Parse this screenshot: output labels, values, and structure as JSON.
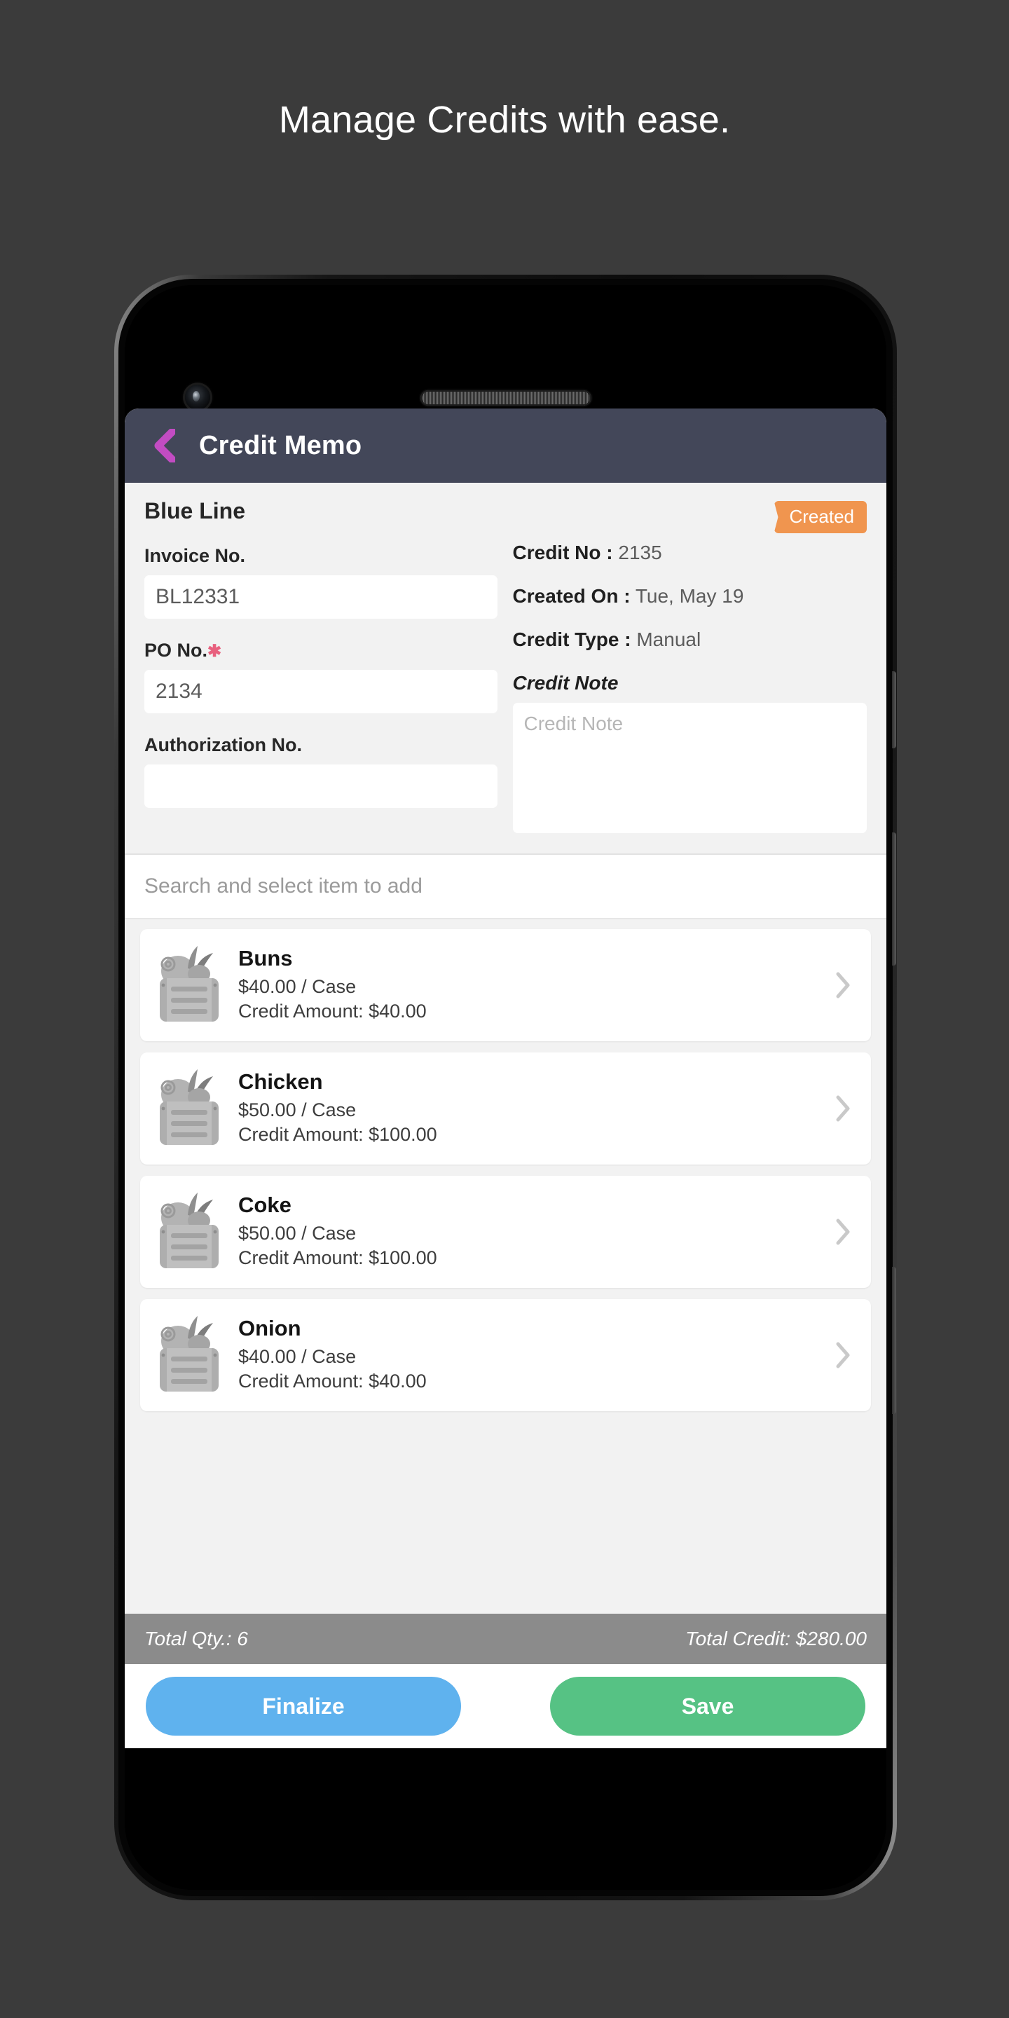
{
  "page": {
    "headline": "Manage Credits with ease.",
    "background_color": "#3b3b3b"
  },
  "appbar": {
    "title": "Credit Memo",
    "back_icon": "chevron-left-icon",
    "background_color": "#434759",
    "back_icon_color": "#c04ac0"
  },
  "form": {
    "customer_name": "Blue Line",
    "status_badge": "Created",
    "status_badge_color": "#f0954f",
    "fields": [
      {
        "label": "Invoice No.",
        "required": false,
        "value": "BL12331",
        "placeholder": ""
      },
      {
        "label": "PO No.",
        "required": true,
        "value": "2134",
        "placeholder": ""
      },
      {
        "label": "Authorization No.",
        "required": false,
        "value": "",
        "placeholder": ""
      }
    ],
    "info": [
      {
        "key": "Credit No :",
        "value": "2135"
      },
      {
        "key": "Created On :",
        "value": "Tue, May 19"
      },
      {
        "key": "Credit Type :",
        "value": "Manual"
      }
    ],
    "note_label": "Credit Note",
    "note_value": "",
    "note_placeholder": "Credit Note"
  },
  "search": {
    "placeholder": "Search and select item to add",
    "value": ""
  },
  "items": [
    {
      "name": "Buns",
      "price": "$40.00 / Case",
      "credit": "Credit Amount: $40.00",
      "thumb": "package-box-icon",
      "chevron": "chevron-right-icon"
    },
    {
      "name": "Chicken",
      "price": "$50.00 / Case",
      "credit": "Credit Amount: $100.00",
      "thumb": "package-box-icon",
      "chevron": "chevron-right-icon"
    },
    {
      "name": "Coke",
      "price": "$50.00 / Case",
      "credit": "Credit Amount: $100.00",
      "thumb": "package-box-icon",
      "chevron": "chevron-right-icon"
    },
    {
      "name": "Onion",
      "price": "$40.00 / Case",
      "credit": "Credit Amount: $40.00",
      "thumb": "package-box-icon",
      "chevron": "chevron-right-icon"
    }
  ],
  "totals": {
    "qty_label": "Total Qty.: 6",
    "credit_label": "Total Credit: $280.00",
    "background_color": "#8b8b8b"
  },
  "actions": {
    "finalize_label": "Finalize",
    "finalize_color": "#5fb2ee",
    "save_label": "Save",
    "save_color": "#56c284"
  }
}
